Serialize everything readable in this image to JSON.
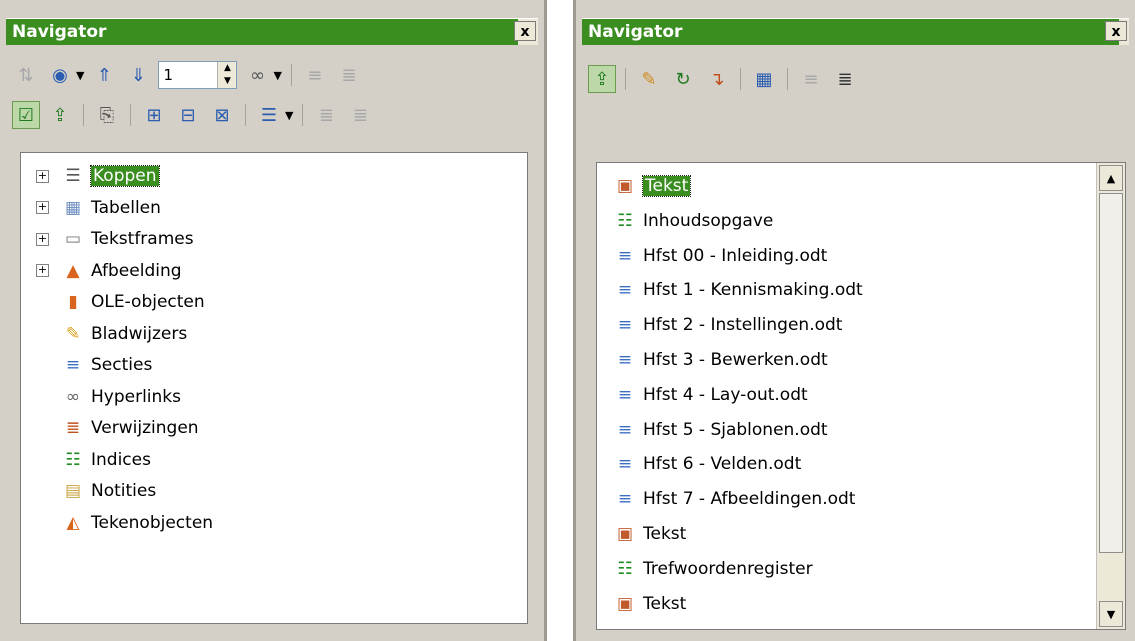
{
  "left": {
    "title": "Navigator",
    "close_label": "x",
    "page_number": "1",
    "items": [
      {
        "label": "Koppen",
        "expandable": true,
        "icon": "headings-icon",
        "glyph": "☰",
        "selected": true
      },
      {
        "label": "Tabellen",
        "expandable": true,
        "icon": "table-icon",
        "glyph": "▦"
      },
      {
        "label": "Tekstframes",
        "expandable": true,
        "icon": "frame-icon",
        "glyph": "▭"
      },
      {
        "label": "Afbeelding",
        "expandable": true,
        "icon": "image-icon",
        "glyph": "▲"
      },
      {
        "label": "OLE-objecten",
        "expandable": false,
        "icon": "ole-chart-icon",
        "glyph": "▮"
      },
      {
        "label": "Bladwijzers",
        "expandable": false,
        "icon": "pushpin-icon",
        "glyph": "✎"
      },
      {
        "label": "Secties",
        "expandable": false,
        "icon": "section-icon",
        "glyph": "≡"
      },
      {
        "label": "Hyperlinks",
        "expandable": false,
        "icon": "link-icon",
        "glyph": "∞"
      },
      {
        "label": "Verwijzingen",
        "expandable": false,
        "icon": "reference-icon",
        "glyph": "≣"
      },
      {
        "label": "Indices",
        "expandable": false,
        "icon": "index-icon",
        "glyph": "☷"
      },
      {
        "label": "Notities",
        "expandable": false,
        "icon": "note-icon",
        "glyph": "▤"
      },
      {
        "label": "Tekenobjecten",
        "expandable": false,
        "icon": "drawing-icon",
        "glyph": "◭"
      }
    ]
  },
  "right": {
    "title": "Navigator",
    "close_label": "x",
    "items": [
      {
        "label": "Tekst",
        "icon": "text-image-icon",
        "glyph": "▣",
        "selected": true
      },
      {
        "label": "Inhoudsopgave",
        "icon": "index-icon",
        "glyph": "☷"
      },
      {
        "label": "Hfst 00 - Inleiding.odt",
        "icon": "section-icon",
        "glyph": "≡"
      },
      {
        "label": "Hfst 1 - Kennismaking.odt",
        "icon": "section-icon",
        "glyph": "≡"
      },
      {
        "label": "Hfst 2 - Instellingen.odt",
        "icon": "section-icon",
        "glyph": "≡"
      },
      {
        "label": "Hfst 3 - Bewerken.odt",
        "icon": "section-icon",
        "glyph": "≡"
      },
      {
        "label": "Hfst 4 - Lay-out.odt",
        "icon": "section-icon",
        "glyph": "≡"
      },
      {
        "label": "Hfst 5 - Sjablonen.odt",
        "icon": "section-icon",
        "glyph": "≡"
      },
      {
        "label": "Hfst 6 - Velden.odt",
        "icon": "section-icon",
        "glyph": "≡"
      },
      {
        "label": "Hfst 7 - Afbeeldingen.odt",
        "icon": "section-icon",
        "glyph": "≡"
      },
      {
        "label": "Tekst",
        "icon": "text-image-icon",
        "glyph": "▣"
      },
      {
        "label": "Trefwoordenregister",
        "icon": "index-icon",
        "glyph": "☷"
      },
      {
        "label": "Tekst",
        "icon": "text-image-icon",
        "glyph": "▣"
      }
    ]
  }
}
